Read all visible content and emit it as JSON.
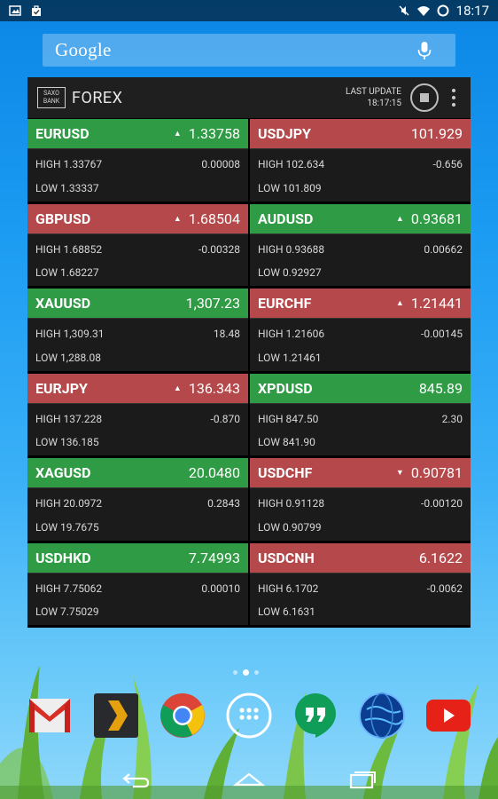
{
  "statusbar": {
    "time": "18:17"
  },
  "search": {
    "brand": "Google"
  },
  "widget": {
    "brand_line1": "SAXO",
    "brand_line2": "BANK",
    "title": "FOREX",
    "last_update_label": "LAST UPDATE",
    "last_update_time": "18:17:15"
  },
  "tiles": [
    {
      "sym": "EURUSD",
      "price": "1.33758",
      "arrow": "▲",
      "high": "HIGH 1.33767",
      "low": "LOW 1.33337",
      "chg": "0.00008",
      "color": "up"
    },
    {
      "sym": "USDJPY",
      "price": "101.929",
      "arrow": "",
      "high": "HIGH 102.634",
      "low": "LOW 101.809",
      "chg": "-0.656",
      "color": "down"
    },
    {
      "sym": "GBPUSD",
      "price": "1.68504",
      "arrow": "▲",
      "high": "HIGH 1.68852",
      "low": "LOW 1.68227",
      "chg": "-0.00328",
      "color": "down"
    },
    {
      "sym": "AUDUSD",
      "price": "0.93681",
      "arrow": "▲",
      "high": "HIGH 0.93688",
      "low": "LOW 0.92927",
      "chg": "0.00662",
      "color": "up"
    },
    {
      "sym": "XAUUSD",
      "price": "1,307.23",
      "arrow": "",
      "high": "HIGH 1,309.31",
      "low": "LOW 1,288.08",
      "chg": "18.48",
      "color": "up"
    },
    {
      "sym": "EURCHF",
      "price": "1.21441",
      "arrow": "▲",
      "high": "HIGH 1.21606",
      "low": "LOW 1.21461",
      "chg": "-0.00145",
      "color": "down"
    },
    {
      "sym": "EURJPY",
      "price": "136.343",
      "arrow": "▲",
      "high": "HIGH 137.228",
      "low": "LOW 136.185",
      "chg": "-0.870",
      "color": "down"
    },
    {
      "sym": "XPDUSD",
      "price": "845.89",
      "arrow": "",
      "high": "HIGH 847.50",
      "low": "LOW 841.90",
      "chg": "2.30",
      "color": "up"
    },
    {
      "sym": "XAGUSD",
      "price": "20.0480",
      "arrow": "",
      "high": "HIGH 20.0972",
      "low": "LOW 19.7675",
      "chg": "0.2843",
      "color": "up"
    },
    {
      "sym": "USDCHF",
      "price": "0.90781",
      "arrow": "▼",
      "high": "HIGH 0.91128",
      "low": "LOW 0.90799",
      "chg": "-0.00120",
      "color": "down"
    },
    {
      "sym": "USDHKD",
      "price": "7.74993",
      "arrow": "",
      "high": "HIGH 7.75062",
      "low": "LOW 7.75029",
      "chg": "0.00010",
      "color": "up"
    },
    {
      "sym": "USDCNH",
      "price": "6.1622",
      "arrow": "",
      "high": "HIGH 6.1702",
      "low": "LOW 6.1631",
      "chg": "-0.0062",
      "color": "down"
    }
  ],
  "colors": {
    "up": "#2f9b45",
    "down": "#b5484a"
  },
  "dock": [
    "gmail-icon",
    "plex-icon",
    "chrome-icon",
    "app-drawer-icon",
    "hangouts-icon",
    "earth-icon",
    "youtube-icon"
  ]
}
